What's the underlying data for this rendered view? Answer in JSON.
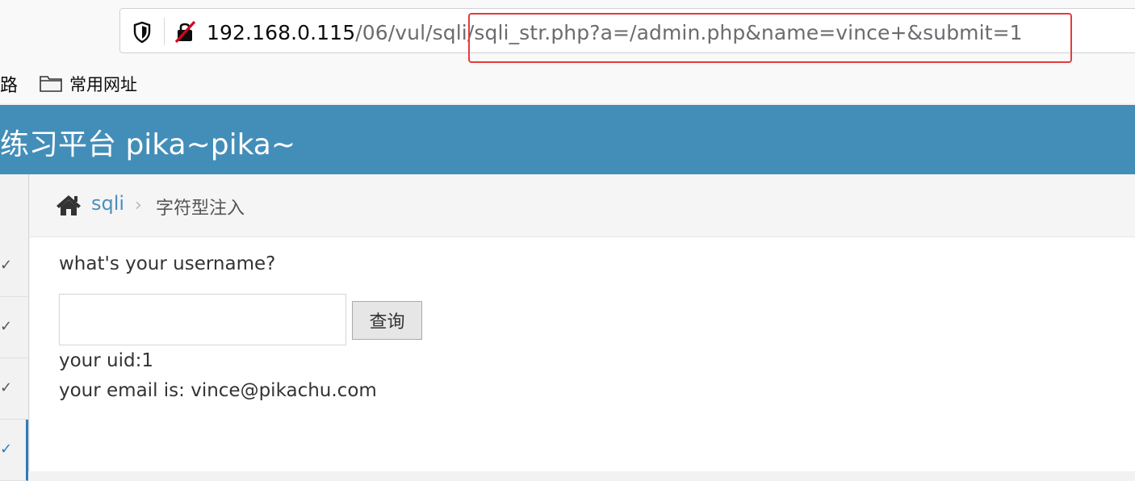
{
  "browser": {
    "url_host": "192.168.0.115",
    "url_path": "/06/vul/sqli/",
    "url_query": "sqli_str.php?a=/admin.php&name=vince+&submit=1",
    "bookmarks_left_fragment": "路",
    "bookmarks_folder_label": "常用网址",
    "highlight_color": "#e53b3b"
  },
  "app": {
    "title": "练习平台 pika~pika~",
    "header_color": "#438eb9"
  },
  "sidebar": {
    "items": [
      {
        "mark": "✓"
      },
      {
        "mark": "✓"
      },
      {
        "mark": "✓"
      },
      {
        "mark": "✓",
        "active": true
      }
    ]
  },
  "breadcrumb": {
    "home_icon": "home-icon",
    "link": "sqli",
    "separator": "›",
    "current": "字符型注入"
  },
  "form": {
    "question": "what's your username?",
    "input_value": "",
    "button_label": "查询"
  },
  "result": {
    "uid_line": "your uid:1",
    "email_line": "your email is: vince@pikachu.com"
  }
}
